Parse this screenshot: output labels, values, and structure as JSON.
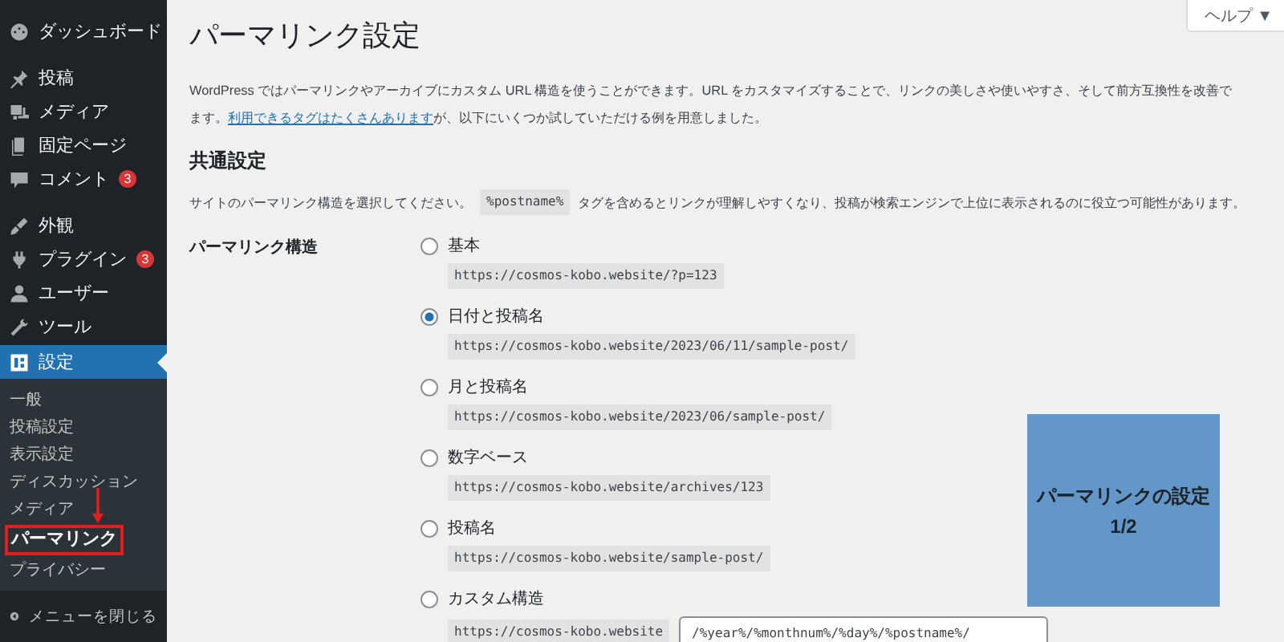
{
  "sidebar": {
    "items": [
      {
        "label": "ダッシュボード",
        "selected": false
      },
      {
        "label": "投稿",
        "selected": false
      },
      {
        "label": "メディア",
        "selected": false
      },
      {
        "label": "固定ページ",
        "selected": false
      },
      {
        "label": "コメント",
        "selected": false,
        "badge": "3"
      },
      {
        "label": "外観",
        "selected": false
      },
      {
        "label": "プラグイン",
        "selected": false,
        "badge": "3"
      },
      {
        "label": "ユーザー",
        "selected": false
      },
      {
        "label": "ツール",
        "selected": false
      },
      {
        "label": "設定",
        "selected": true
      }
    ],
    "submenu": [
      {
        "label": "一般",
        "selected": false
      },
      {
        "label": "投稿設定",
        "selected": false
      },
      {
        "label": "表示設定",
        "selected": false
      },
      {
        "label": "ディスカッション",
        "selected": false
      },
      {
        "label": "メディア",
        "selected": false
      },
      {
        "label": "パーマリンク",
        "selected": true
      },
      {
        "label": "プライバシー",
        "selected": false
      }
    ],
    "collapse": "メニューを閉じる"
  },
  "help_button": "ヘルプ ▼",
  "title": "パーマリンク設定",
  "intro_lines": [
    "WordPress ではパーマリンクやアーカイブにカスタム URL 構造を使うことができます。URL をカスタマイズすることで、リンクの美しさや使いやすさ、そして前方互換性を改善で"
  ],
  "intro_line2": {
    "before": "ます。",
    "link": "利用できるタグはたくさんあります",
    "after": "が、以下にいくつか試していただける例を用意しました。"
  },
  "section_title": "共通設定",
  "description": {
    "before": "サイトのパーマリンク構造を選択してください。",
    "code": "%postname%",
    "after": "タグを含めるとリンクが理解しやすくなり、投稿が検索エンジンで上位に表示されるのに役立つ可能性があります。"
  },
  "field_label": "パーマリンク構造",
  "options": [
    {
      "label": "基本",
      "example": "https://cosmos-kobo.website/?p=123",
      "selected": false,
      "kind": "example"
    },
    {
      "label": "日付と投稿名",
      "example": "https://cosmos-kobo.website/2023/06/11/sample-post/",
      "selected": true,
      "kind": "example"
    },
    {
      "label": "月と投稿名",
      "example": "https://cosmos-kobo.website/2023/06/sample-post/",
      "selected": false,
      "kind": "example"
    },
    {
      "label": "数字ベース",
      "example": "https://cosmos-kobo.website/archives/123",
      "selected": false,
      "kind": "example"
    },
    {
      "label": "投稿名",
      "example": "https://cosmos-kobo.website/sample-post/",
      "selected": false,
      "kind": "example"
    },
    {
      "label": "カスタム構造",
      "example": "https://cosmos-kobo.website",
      "value": "/%year%/%monthnum%/%day%/%postname%/",
      "selected": false,
      "kind": "custom"
    }
  ],
  "overlay_note": {
    "lines": [
      "パーマリンクの設定",
      "1/2"
    ]
  }
}
